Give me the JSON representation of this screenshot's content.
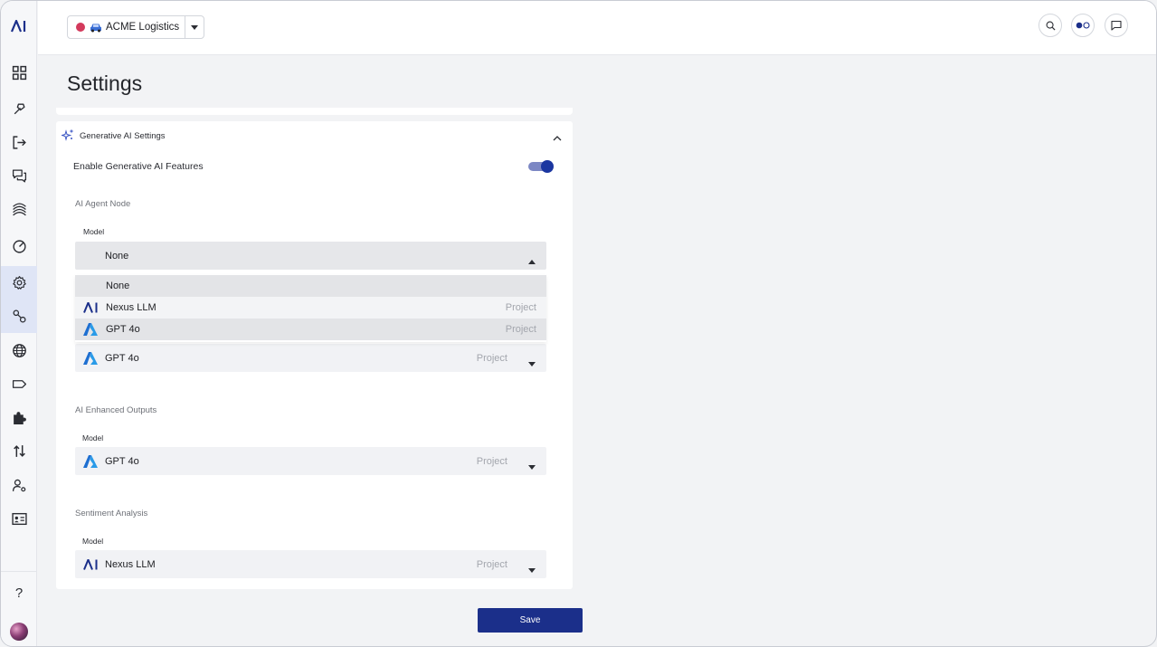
{
  "brand": {
    "logo_text": "AI"
  },
  "header": {
    "project_name": "ACME Logistics",
    "project_dot_color": "#d33a5c"
  },
  "page": {
    "title": "Settings"
  },
  "genai": {
    "section_title": "Generative AI Settings",
    "enable_label": "Enable Generative AI Features",
    "enabled": true,
    "agent_node": {
      "title": "AI Agent Node",
      "model_label": "Model",
      "selected": "None",
      "options": [
        {
          "label": "None",
          "tag": ""
        },
        {
          "label": "Nexus LLM",
          "tag": "Project",
          "icon": "nexus-logo-icon"
        },
        {
          "label": "GPT 4o",
          "tag": "Project",
          "icon": "azure-logo-icon"
        }
      ],
      "second_select": {
        "label": "GPT 4o",
        "tag": "Project"
      }
    },
    "enhanced_outputs": {
      "title": "AI Enhanced Outputs",
      "model_label": "Model",
      "selected": {
        "label": "GPT 4o",
        "tag": "Project"
      }
    },
    "sentiment": {
      "title": "Sentiment Analysis",
      "model_label": "Model",
      "selected": {
        "label": "Nexus LLM",
        "tag": "Project"
      }
    }
  },
  "actions": {
    "save_label": "Save"
  },
  "help_label": "?",
  "colors": {
    "accent": "#1b2f8a",
    "toggle_on": "#1b36a0"
  }
}
